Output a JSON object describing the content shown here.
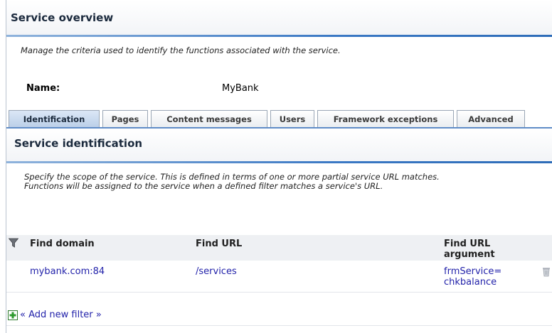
{
  "page": {
    "title": "Service overview",
    "description": "Manage the criteria used to identify the functions associated with the service."
  },
  "name_field": {
    "label": "Name:",
    "value": "MyBank"
  },
  "tabs": [
    {
      "label": "Identification",
      "active": true
    },
    {
      "label": "Pages",
      "active": false
    },
    {
      "label": "Content messages",
      "active": false
    },
    {
      "label": "Users",
      "active": false
    },
    {
      "label": "Framework exceptions",
      "active": false
    },
    {
      "label": "Advanced",
      "active": false
    }
  ],
  "section": {
    "title": "Service identification",
    "description_line1": "Specify the scope of the service. This is defined in terms of one or more partial service URL matches.",
    "description_line2": "Functions will be assigned to the service when a defined filter matches a service's URL."
  },
  "table": {
    "headers": {
      "domain": "Find domain",
      "url": "Find URL",
      "argument_line1": "Find URL",
      "argument_line2": "argument"
    },
    "rows": [
      {
        "domain": "mybank.com:84",
        "url": "/services",
        "argument_line1": "frmService=",
        "argument_line2": "chkbalance"
      }
    ]
  },
  "add_filter": {
    "label": "« Add new filter »"
  },
  "icons": {
    "filter": "filter-funnel-icon",
    "delete": "trash-icon",
    "add": "add-plus-icon"
  },
  "colors": {
    "accent_rule": "#3a78c4",
    "link": "#2222aa",
    "tab_active": "#b9cde7",
    "add_icon_green": "#2e9a2e"
  }
}
